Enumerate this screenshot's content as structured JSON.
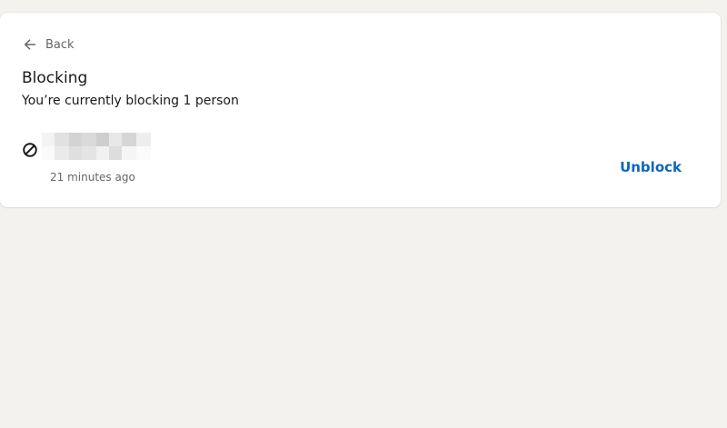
{
  "nav": {
    "back_label": "Back",
    "back_icon": "arrow-left-icon"
  },
  "header": {
    "title": "Blocking",
    "subtitle": "You’re currently blocking 1 person"
  },
  "blocked_list": [
    {
      "name": "",
      "name_obscured": true,
      "icon": "block-icon",
      "time": "21 minutes ago",
      "action_label": "Unblock"
    }
  ],
  "colors": {
    "page_background": "#f3f2ef",
    "card_background": "#ffffff",
    "action_link": "#0a66c2",
    "primary_text": "#191919",
    "secondary_text": "#666666"
  }
}
